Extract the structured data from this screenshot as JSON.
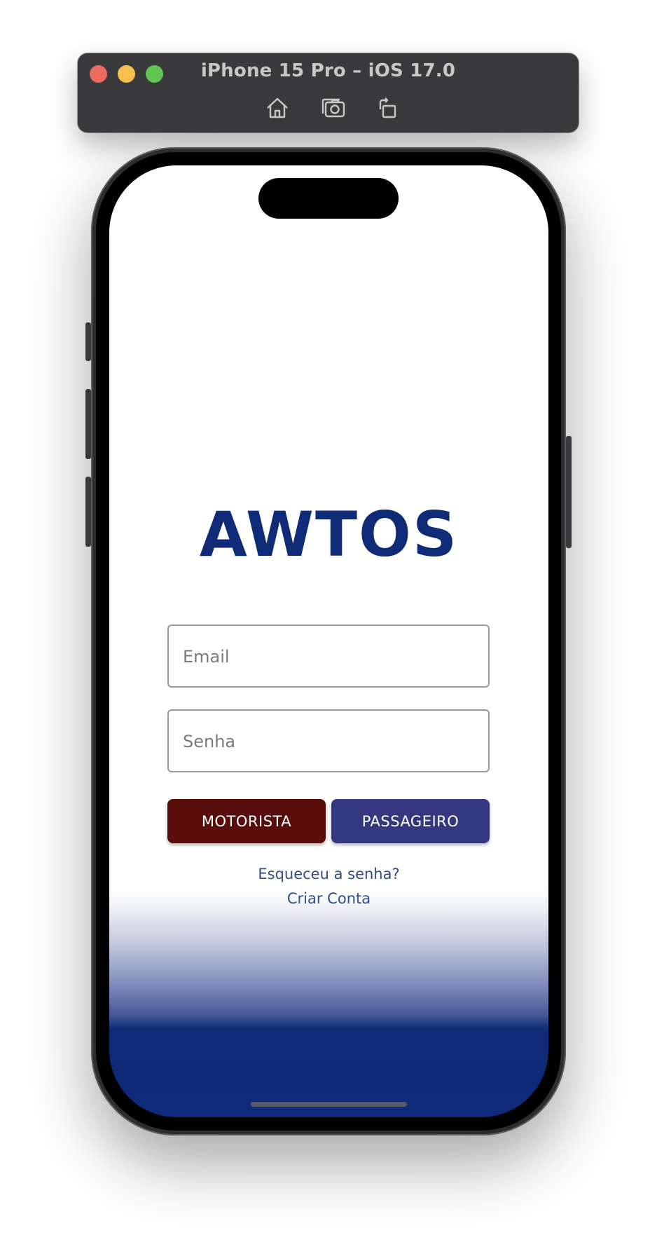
{
  "simulator": {
    "title": "iPhone 15 Pro – iOS 17.0",
    "toolbar_icons": [
      "home-icon",
      "screenshot-icon",
      "rotate-icon"
    ]
  },
  "app": {
    "logo": "AWTOS",
    "email_placeholder": "Email",
    "password_placeholder": "Senha",
    "driver_button": "MOTORISTA",
    "passenger_button": "PASSAGEIRO",
    "forgot_password_link": "Esqueceu a senha?",
    "create_account_link": "Criar Conta"
  },
  "colors": {
    "brand": "#0f2a76",
    "driver_button": "#5a0e0c",
    "passenger_button": "#343880",
    "link": "#2f4d8a"
  }
}
